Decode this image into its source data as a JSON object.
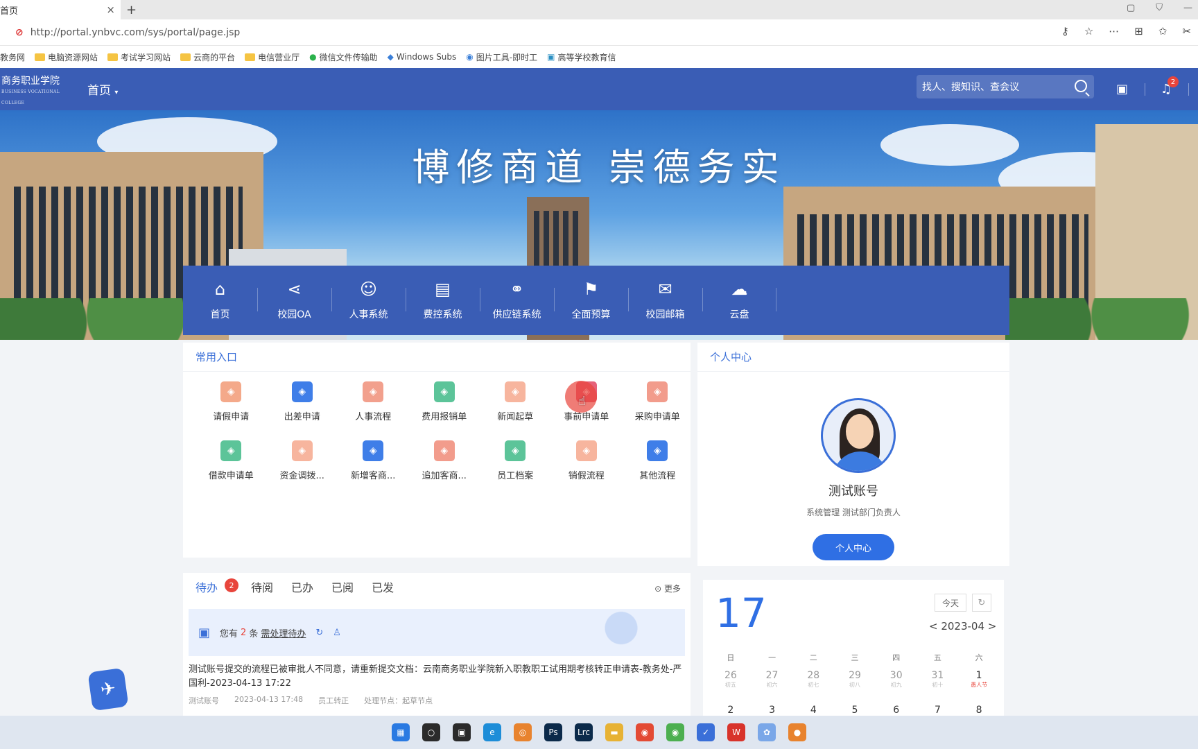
{
  "browser": {
    "tab_title": "首页",
    "url": "http://portal.ynbvc.com/sys/portal/page.jsp",
    "bookmarks": [
      "教务网",
      "电脑资源网站",
      "考试学习网站",
      "云商的平台",
      "电信营业厅",
      "微信文件传输助",
      "Windows Subs",
      "图片工具-即时工",
      "高等学校教育信"
    ]
  },
  "header": {
    "logo_text": "商务职业学院",
    "logo_sub": "BUSINESS VOCATIONAL COLLEGE",
    "home_menu": "首页",
    "search_placeholder": "找人、搜知识、查会议",
    "notification_count": "2"
  },
  "banner": {
    "slogan": "博修商道 崇德务实"
  },
  "apps": [
    {
      "label": "首页",
      "icon": "home-icon",
      "glyph": "⌂"
    },
    {
      "label": "校园OA",
      "icon": "share-icon",
      "glyph": "⋖"
    },
    {
      "label": "人事系统",
      "icon": "user-icon",
      "glyph": "☺"
    },
    {
      "label": "费控系统",
      "icon": "document-icon",
      "glyph": "▤"
    },
    {
      "label": "供应链系统",
      "icon": "chain-icon",
      "glyph": "⚭"
    },
    {
      "label": "全面预算",
      "icon": "chart-icon",
      "glyph": "⚑"
    },
    {
      "label": "校园邮箱",
      "icon": "mail-icon",
      "glyph": "✉"
    },
    {
      "label": "云盘",
      "icon": "cloud-icon",
      "glyph": "☁"
    }
  ],
  "quick": {
    "title": "常用入口",
    "items": [
      {
        "label": "请假申请",
        "color": "#f4a98a"
      },
      {
        "label": "出差申请",
        "color": "#3f7ee8"
      },
      {
        "label": "人事流程",
        "color": "#f2a08d"
      },
      {
        "label": "费用报销单",
        "color": "#5cc499"
      },
      {
        "label": "新闻起草",
        "color": "#f7b59e"
      },
      {
        "label": "事前申请单",
        "color": "#e6627a"
      },
      {
        "label": "采购申请单",
        "color": "#f29c8c"
      },
      {
        "label": "借款申请单",
        "color": "#5cc499"
      },
      {
        "label": "资金调拨...",
        "color": "#f7b59e"
      },
      {
        "label": "新增客商...",
        "color": "#3f7ee8"
      },
      {
        "label": "追加客商...",
        "color": "#f29c8c"
      },
      {
        "label": "员工档案",
        "color": "#5cc499"
      },
      {
        "label": "销假流程",
        "color": "#f7b59e"
      },
      {
        "label": "其他流程",
        "color": "#3f7ee8"
      }
    ]
  },
  "personal": {
    "title": "个人中心",
    "name": "测试账号",
    "dept": "系统管理 测试部门负责人",
    "button": "个人中心"
  },
  "todo": {
    "tabs": [
      "待办",
      "待阅",
      "已办",
      "已阅",
      "已发"
    ],
    "badge": "2",
    "more": "更多",
    "notice_prefix": "您有",
    "notice_count": "2",
    "notice_mid": "条",
    "notice_link": "需处理待办",
    "item_text": "测试账号提交的流程已被审批人不同意，请重新提交文档：云南商务职业学院新入职教职工试用期考核转正申请表-教务处-严国利-2023-04-13 17:22",
    "meta": [
      "测试账号",
      "2023-04-13 17:48",
      "员工转正",
      "处理节点：起草节点"
    ]
  },
  "calendar": {
    "day": "17",
    "today": "今天",
    "month": "< 2023-04 >",
    "weekdays": [
      "日",
      "一",
      "二",
      "三",
      "四",
      "五",
      "六"
    ],
    "rows": [
      [
        {
          "d": "26",
          "l": "初五"
        },
        {
          "d": "27",
          "l": "初六"
        },
        {
          "d": "28",
          "l": "初七"
        },
        {
          "d": "29",
          "l": "初八"
        },
        {
          "d": "30",
          "l": "初九"
        },
        {
          "d": "31",
          "l": "初十"
        },
        {
          "d": "1",
          "l": "愚人节"
        }
      ],
      [
        {
          "d": "2",
          "l": ""
        },
        {
          "d": "3",
          "l": ""
        },
        {
          "d": "4",
          "l": ""
        },
        {
          "d": "5",
          "l": ""
        },
        {
          "d": "6",
          "l": ""
        },
        {
          "d": "7",
          "l": ""
        },
        {
          "d": "8",
          "l": ""
        }
      ]
    ]
  },
  "taskbar": [
    {
      "name": "windows-start-icon",
      "color": "#2a7ae2",
      "glyph": "▦"
    },
    {
      "name": "search-icon",
      "color": "#2b2b2b",
      "glyph": "○"
    },
    {
      "name": "task-view-icon",
      "color": "#2b2b2b",
      "glyph": "▣"
    },
    {
      "name": "edge-icon",
      "color": "#1d8dd8",
      "glyph": "e"
    },
    {
      "name": "magnifier-icon",
      "color": "#e8832e",
      "glyph": "◎"
    },
    {
      "name": "photoshop-icon",
      "color": "#0b2a4a",
      "glyph": "Ps"
    },
    {
      "name": "lightroom-icon",
      "color": "#0b2a4a",
      "glyph": "Lrc"
    },
    {
      "name": "file-explorer-icon",
      "color": "#e7b234",
      "glyph": "▬"
    },
    {
      "name": "chrome-icon",
      "color": "#e34a34",
      "glyph": "◉"
    },
    {
      "name": "chrome-alt-icon",
      "color": "#4caf50",
      "glyph": "◉"
    },
    {
      "name": "bird-app-icon",
      "color": "#3a6fd8",
      "glyph": "✓"
    },
    {
      "name": "wps-icon",
      "color": "#d8332b",
      "glyph": "W"
    },
    {
      "name": "network-app-icon",
      "color": "#7aa7e8",
      "glyph": "✿"
    },
    {
      "name": "game-app-icon",
      "color": "#e8832e",
      "glyph": "●"
    }
  ]
}
